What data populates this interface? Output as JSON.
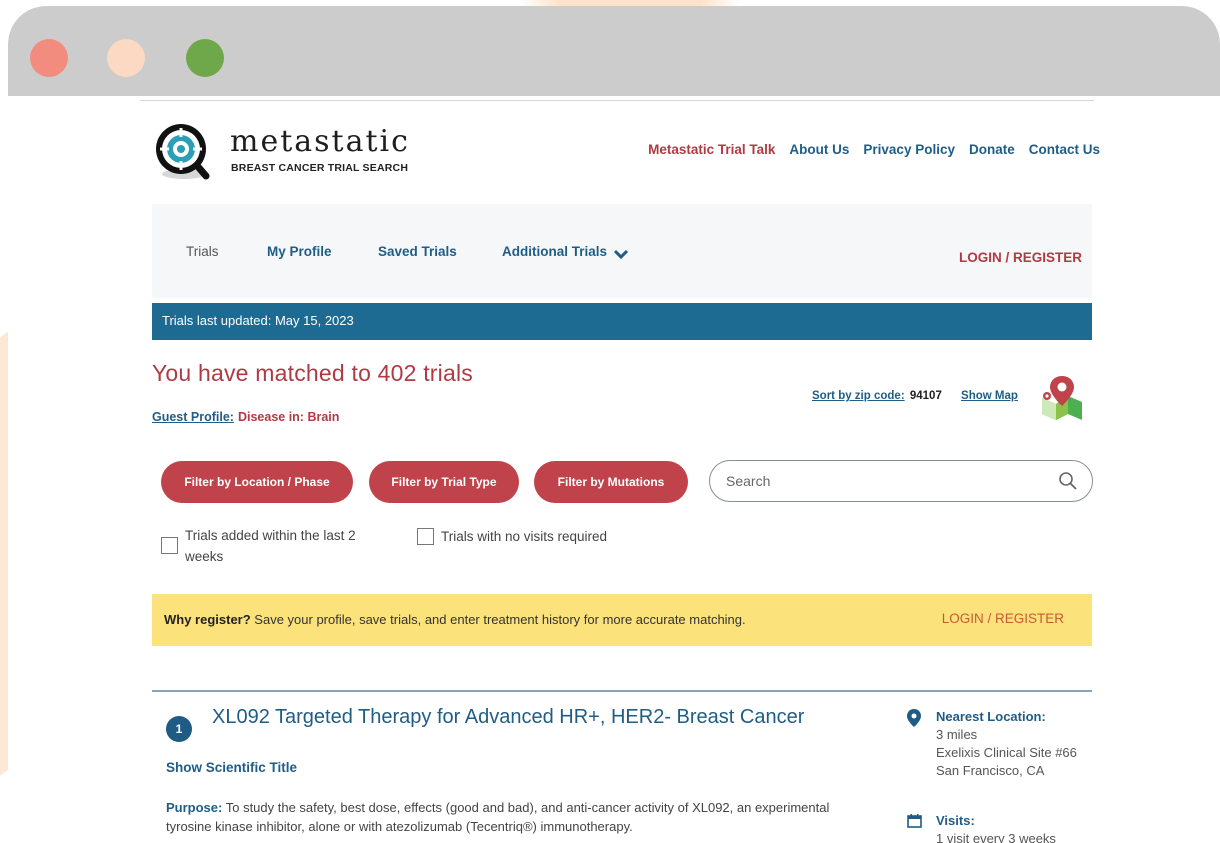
{
  "logo": {
    "title": "metastatic",
    "subtitle": "BREAST CANCER TRIAL SEARCH"
  },
  "top_links": [
    "Metastatic Trial Talk",
    "About Us",
    "Privacy Policy",
    "Donate",
    "Contact Us"
  ],
  "nav": {
    "trials": "Trials",
    "my_profile": "My Profile",
    "saved_trials": "Saved Trials",
    "additional_trials": "Additional Trials",
    "login": "LOGIN / REGISTER"
  },
  "updated_bar": "Trials last updated: May 15, 2023",
  "results": {
    "matched": "You have matched to 402 trials",
    "guest_label": "Guest Profile:",
    "guest_value": "Disease in: Brain",
    "sort_label": "Sort by zip code:",
    "zip": "94107",
    "show_map": "Show Map"
  },
  "filters": {
    "location": "Filter by Location / Phase",
    "trial_type": "Filter by Trial Type",
    "mutations": "Filter by Mutations",
    "search_placeholder": "Search"
  },
  "checkboxes": {
    "recent": "Trials added within the last 2 weeks",
    "no_visits": "Trials with no visits required"
  },
  "banner": {
    "bold": "Why register?",
    "text": " Save your profile, save trials, and enter treatment history for more accurate matching.",
    "login": "LOGIN / REGISTER"
  },
  "trial": {
    "number": "1",
    "title": "XL092 Targeted Therapy for Advanced HR+, HER2- Breast Cancer",
    "show_scientific": "Show Scientific Title",
    "purpose_label": "Purpose:",
    "purpose_text": " To study the safety, best dose, effects (good and bad), and anti-cancer activity of XL092, an experimental tyrosine kinase inhibitor, alone or with atezolizumab (Tecentriq®) immunotherapy.",
    "nearest_label": "Nearest Location:",
    "distance": "3 miles",
    "site": "Exelixis Clinical Site #66",
    "city": "San Francisco, CA",
    "visits_label": "Visits:",
    "visits_value": "1 visit every 3 weeks"
  },
  "colors": {
    "brand_red": "#c0424a",
    "brand_blue": "#1f5d87",
    "bar_blue": "#1d6b92",
    "banner_yellow": "#fce27a"
  }
}
